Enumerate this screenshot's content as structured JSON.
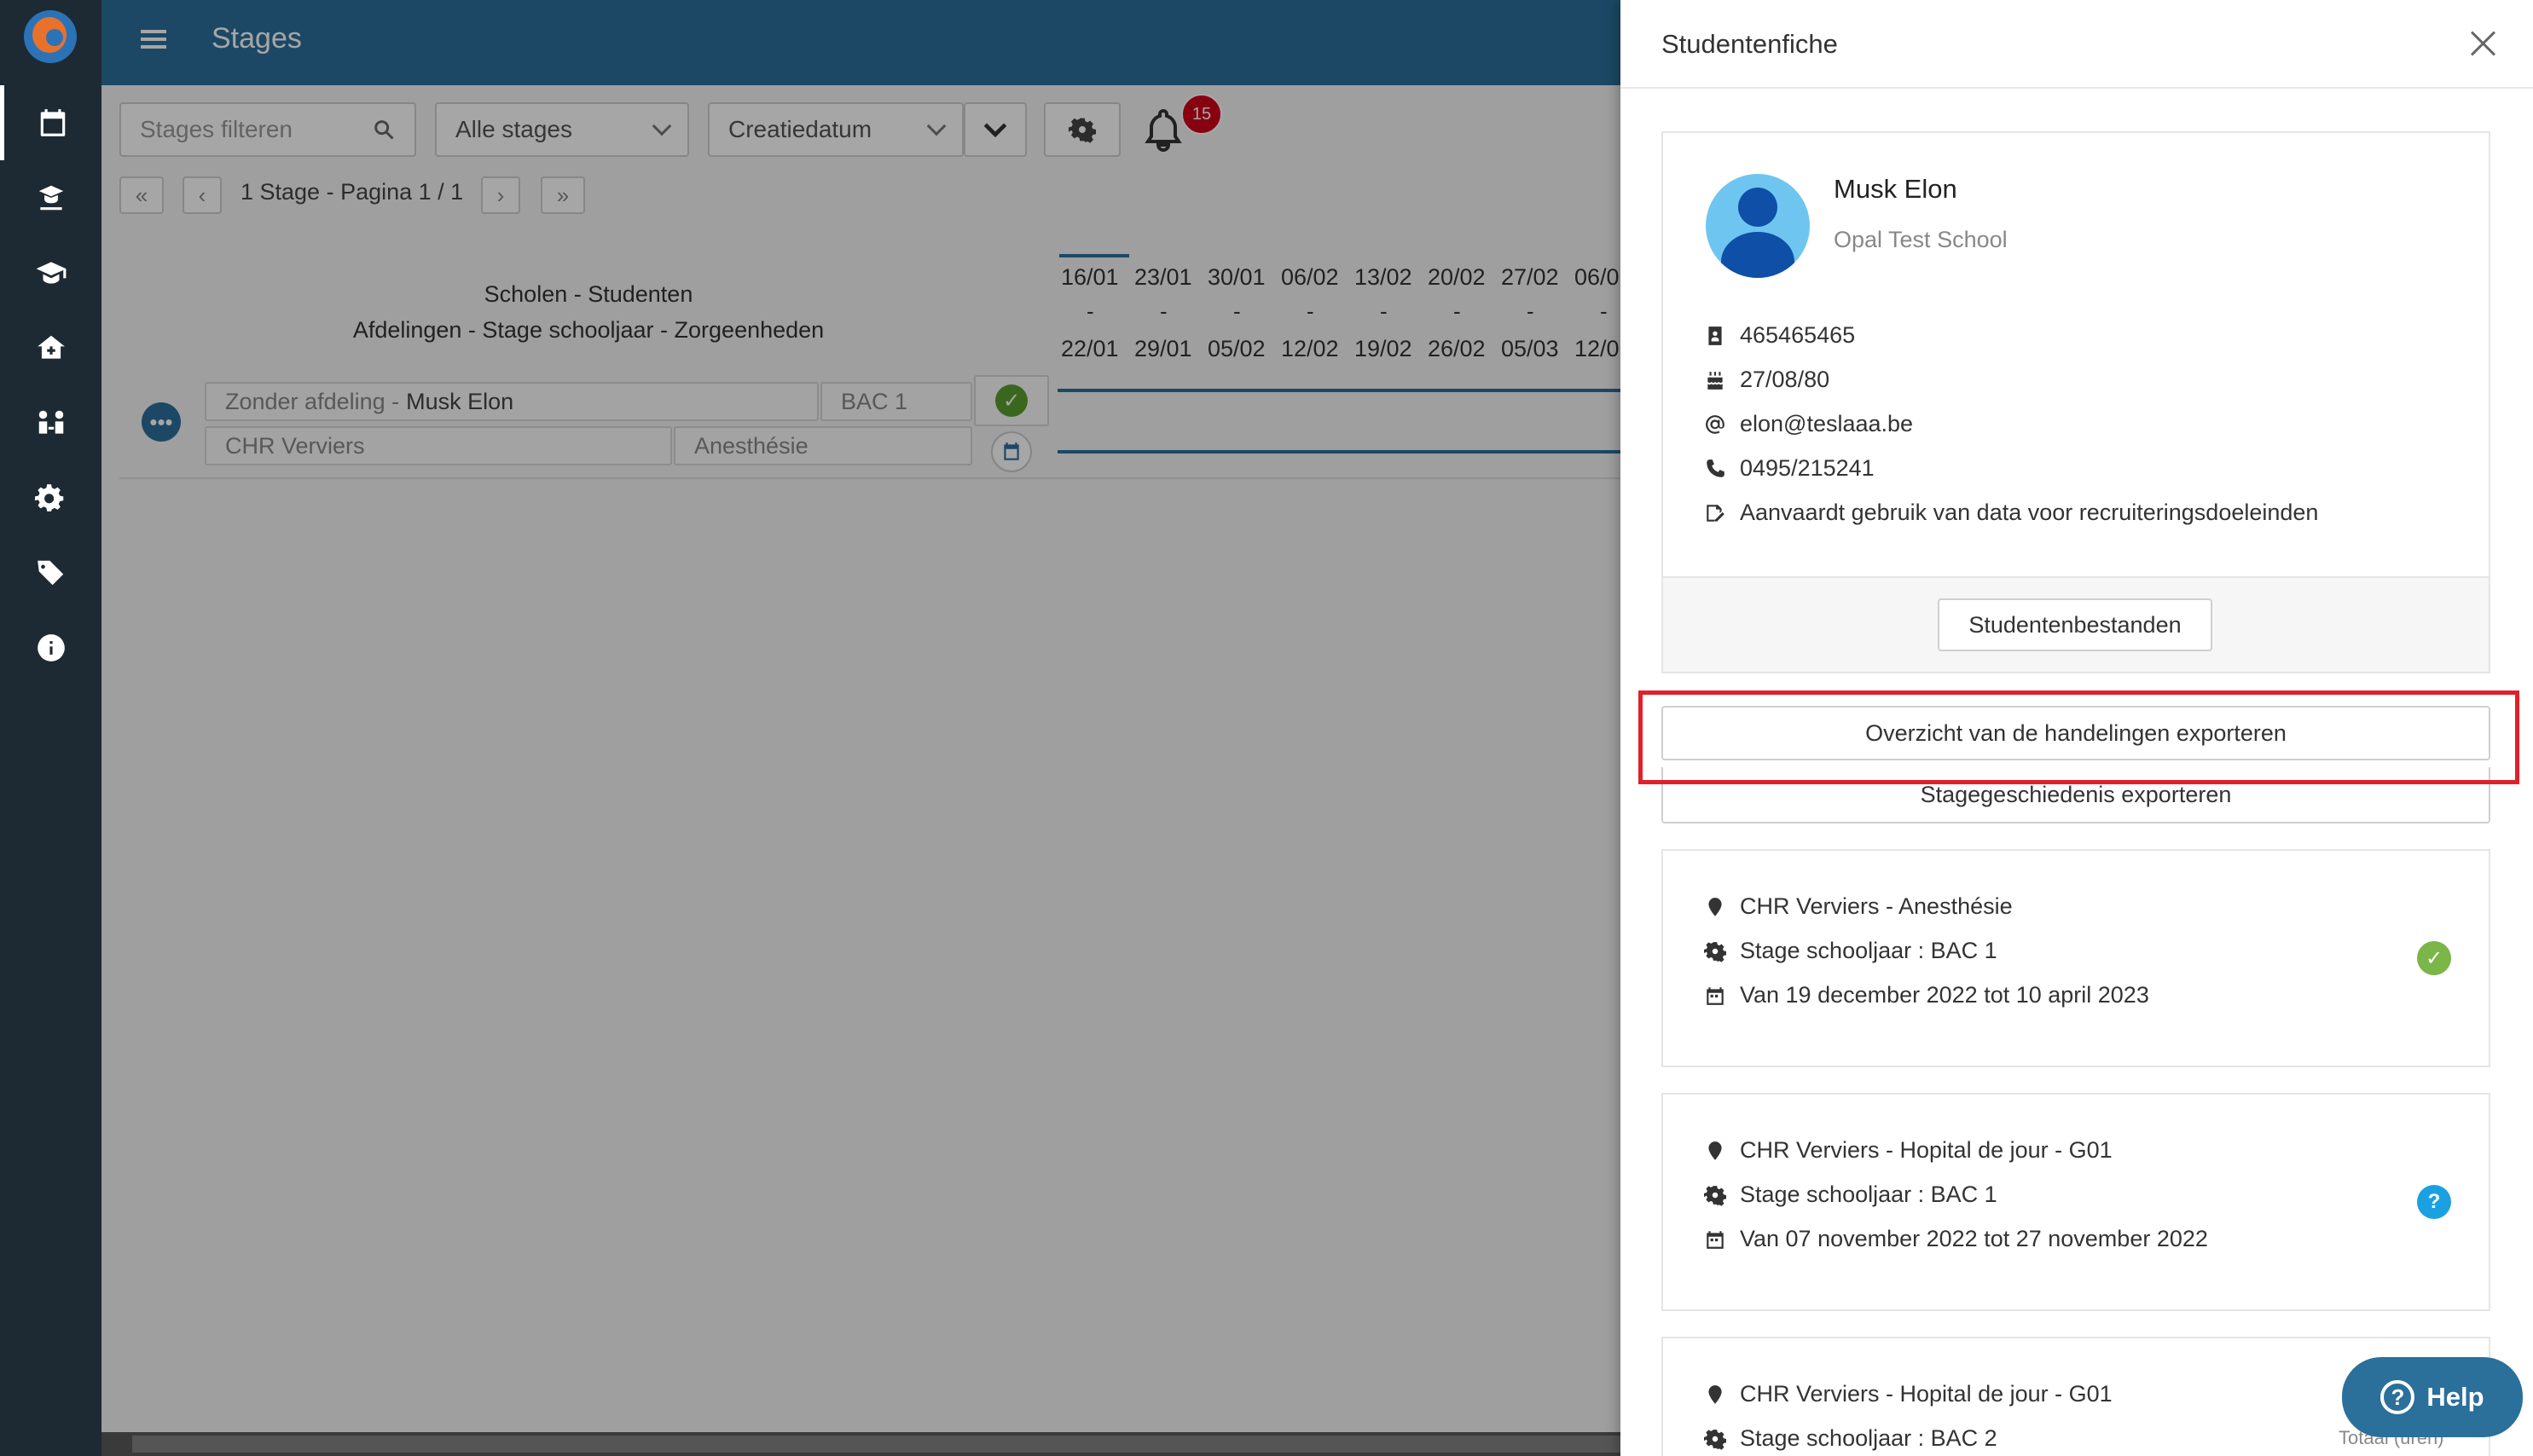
{
  "header": {
    "title": "Stages"
  },
  "toolbar": {
    "filter_placeholder": "Stages filteren",
    "filter_value": "",
    "stage_select": "Alle stages",
    "sort_select": "Creatiedatum",
    "notification_count": "15"
  },
  "pager": {
    "text": "1 Stage - Pagina 1 / 1",
    "first": "«",
    "prev": "‹",
    "next": "›",
    "last": "»"
  },
  "grid": {
    "header_line1": "Scholen - Studenten",
    "header_line2": "Afdelingen - Stage schooljaar - Zorgeenheden",
    "dates_top": [
      "16/01",
      "23/01",
      "30/01",
      "06/02",
      "13/02",
      "20/02",
      "27/02",
      "06/0"
    ],
    "dates_bottom": [
      "22/01",
      "29/01",
      "05/02",
      "12/02",
      "19/02",
      "26/02",
      "05/03",
      "12/0"
    ],
    "row": {
      "dept_prefix": "Zonder afdeling -",
      "student": "Musk Elon",
      "level": "BAC 1",
      "hospital": "CHR Verviers",
      "unit": "Anesthésie"
    }
  },
  "panel": {
    "title": "Studentenfiche",
    "student": {
      "name": "Musk Elon",
      "school": "Opal Test School",
      "id": "465465465",
      "birthdate": "27/08/80",
      "email": "elon@teslaaa.be",
      "phone": "0495/215241",
      "consent": "Aanvaardt gebruik van data voor recruiteringsdoeleinden"
    },
    "files_button": "Studentenbestanden",
    "export_actions": "Overzicht van de handelingen exporteren",
    "export_history": "Stagegeschiedenis exporteren",
    "internships": [
      {
        "location": "CHR Verviers - Anesthésie",
        "year": "Stage schooljaar : BAC 1",
        "period": "Van 19 december 2022 tot 10 april 2023",
        "status": "done",
        "status_color": "#7ab648"
      },
      {
        "location": "CHR Verviers - Hopital de jour - G01",
        "year": "Stage schooljaar : BAC 1",
        "period": "Van 07 november 2022 tot 27 november 2022",
        "status": "unknown",
        "status_color": "#1ba1e2"
      },
      {
        "location": "CHR Verviers - Hopital de jour - G01",
        "year": "Stage schooljaar : BAC 2"
      }
    ],
    "totaal_label": "Totaal (uren)"
  },
  "help": {
    "label": "Help"
  },
  "colors": {
    "header": "#2b6f9b",
    "sidenav": "#1d2a33",
    "highlight": "#e0202a",
    "badge": "#d0021b"
  }
}
